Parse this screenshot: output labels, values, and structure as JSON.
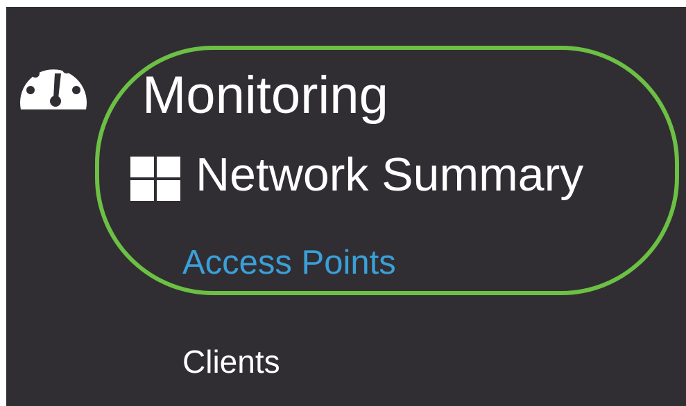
{
  "nav": {
    "section": {
      "label": "Monitoring",
      "icon": "dashboard-gauge-icon"
    },
    "items": [
      {
        "label": "Network Summary",
        "icon": "grid-icon",
        "state": "expanded"
      },
      {
        "label": "Access Points",
        "state": "active"
      },
      {
        "label": "Clients"
      }
    ]
  },
  "colors": {
    "background": "#302e33",
    "text": "#ffffff",
    "active_link": "#3aa0d9",
    "highlight": "#6cc043"
  }
}
